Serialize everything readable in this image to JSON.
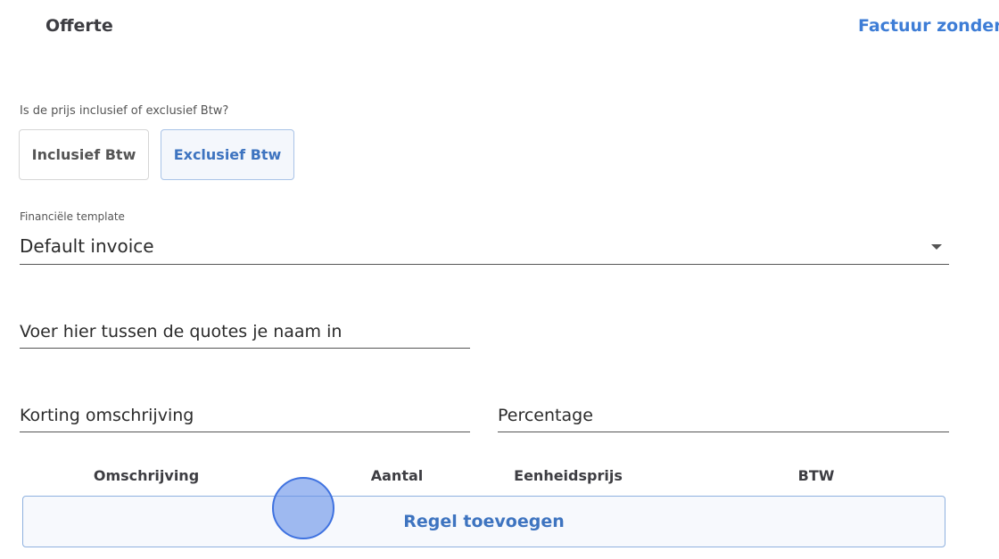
{
  "tabs": {
    "offerte": "Offerte",
    "factuur": "Factuur zonder"
  },
  "vat": {
    "question": "Is de prijs inclusief of exclusief Btw?",
    "inclusive_label": "Inclusief Btw",
    "exclusive_label": "Exclusief Btw",
    "selected": "Exclusief Btw"
  },
  "template": {
    "label": "Financiële template",
    "value": "Default invoice"
  },
  "fields": {
    "name_placeholder": "Voer hier tussen de quotes je naam in",
    "discount_placeholder": "Korting omschrijving",
    "percentage_placeholder": "Percentage"
  },
  "table": {
    "columns": [
      "Omschrijving",
      "Aantal",
      "Eenheidsprijs",
      "BTW"
    ]
  },
  "add_row_label": "Regel toevoegen",
  "colors": {
    "accent": "#3e7dd6",
    "selected_bg": "#f4f7fc",
    "click_indicator": "#3f72e0"
  }
}
